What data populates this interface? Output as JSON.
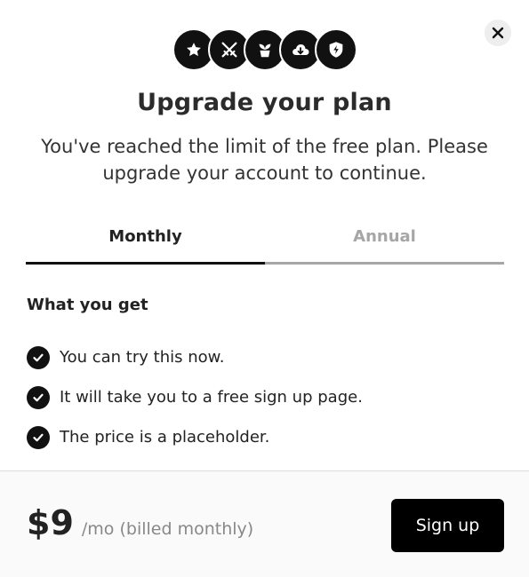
{
  "header": {
    "icons": [
      "star-icon",
      "swords-icon",
      "plant-pot-icon",
      "cloud-download-icon",
      "shield-bolt-icon"
    ],
    "close_icon": "close-icon"
  },
  "title": "Upgrade your plan",
  "subtitle": "You've reached the limit of the free plan. Please upgrade your account to continue.",
  "tabs": [
    {
      "label": "Monthly",
      "active": true
    },
    {
      "label": "Annual",
      "active": false
    }
  ],
  "benefits": {
    "heading": "What you get",
    "items": [
      "You can try this now.",
      "It will take you to a free sign up page.",
      "The price is a placeholder."
    ]
  },
  "footer": {
    "price": "$9",
    "period": "/mo (billed monthly)",
    "signup_label": "Sign up"
  },
  "colors": {
    "accent": "#111111",
    "inactive_tab": "#a6a6a6",
    "footer_bg": "#fafafa"
  }
}
